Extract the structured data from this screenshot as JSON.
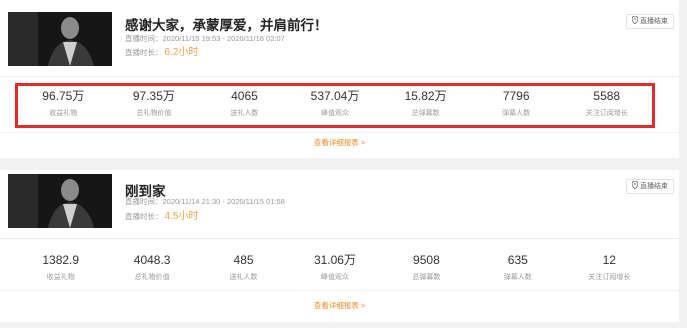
{
  "broadcasts": [
    {
      "title": "感谢大家，承蒙厚爱，并肩前行！",
      "time_label": "直播时间：",
      "time_value": "2020/11/15 19:53 - 2020/11/16 02:07",
      "duration_label": "直播时长：",
      "duration_value": "6.2小时",
      "end_button": "直播结束",
      "detail_link": "查看详细报表 >",
      "stats": [
        {
          "value": "96.75万",
          "label": "收益礼物"
        },
        {
          "value": "97.35万",
          "label": "总礼物价值"
        },
        {
          "value": "4065",
          "label": "送礼人数"
        },
        {
          "value": "537.04万",
          "label": "峰值观众"
        },
        {
          "value": "15.82万",
          "label": "总弹幕数"
        },
        {
          "value": "7796",
          "label": "弹幕人数"
        },
        {
          "value": "5588",
          "label": "关注订阅增长"
        }
      ]
    },
    {
      "title": "刚到家",
      "time_label": "直播时间：",
      "time_value": "2020/11/14 21:30 - 2020/11/15 01:58",
      "duration_label": "直播时长：",
      "duration_value": "4.5小时",
      "end_button": "直播结束",
      "detail_link": "查看详细报表 >",
      "stats": [
        {
          "value": "1382.9",
          "label": "收益礼物"
        },
        {
          "value": "4048.3",
          "label": "总礼物价值"
        },
        {
          "value": "485",
          "label": "送礼人数"
        },
        {
          "value": "31.06万",
          "label": "峰值观众"
        },
        {
          "value": "9508",
          "label": "总弹幕数"
        },
        {
          "value": "635",
          "label": "弹幕人数"
        },
        {
          "value": "12",
          "label": "关注订阅增长"
        }
      ]
    }
  ],
  "colors": {
    "accent": "#f08a24",
    "highlight_border": "#e32b2b"
  },
  "icons": {
    "end_button": "location-pin-icon"
  }
}
